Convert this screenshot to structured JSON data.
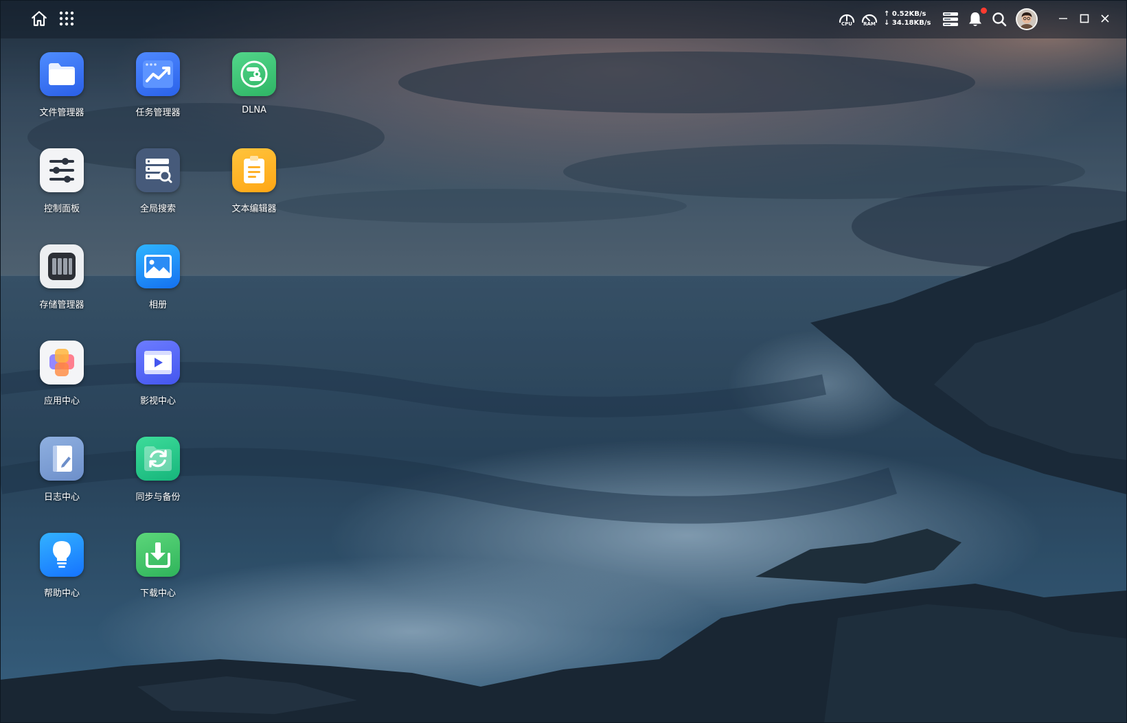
{
  "colors": {
    "topbar": "#141e2a",
    "notification_dot": "#ff3b30",
    "label_text": "#ffffff"
  },
  "topbar": {
    "home_icon": "home-icon",
    "apps_icon": "grid-icon",
    "cpu_label": "CPU",
    "ram_label": "RAM",
    "upload_speed": "↑ 0.52KB/s",
    "download_speed": "↓ 34.18KB/s",
    "storage_icon": "storage-icon",
    "bell_icon": "bell-icon",
    "search_icon": "search-icon",
    "avatar_icon": "avatar",
    "minimize_icon": "minimize-icon",
    "maximize_icon": "maximize-icon",
    "close_icon": "close-icon"
  },
  "desktop": {
    "icons": [
      {
        "label": "文件管理器",
        "icon": "folder-icon"
      },
      {
        "label": "任务管理器",
        "icon": "task-manager-icon"
      },
      {
        "label": "DLNA",
        "icon": "dlna-icon"
      },
      {
        "label": "控制面板",
        "icon": "control-panel-icon"
      },
      {
        "label": "全局搜索",
        "icon": "global-search-icon"
      },
      {
        "label": "文本编辑器",
        "icon": "text-editor-icon"
      },
      {
        "label": "存储管理器",
        "icon": "storage-manager-icon"
      },
      {
        "label": "相册",
        "icon": "photo-album-icon"
      },
      {
        "label": "应用中心",
        "icon": "app-center-icon"
      },
      {
        "label": "影视中心",
        "icon": "video-center-icon"
      },
      {
        "label": "日志中心",
        "icon": "log-center-icon"
      },
      {
        "label": "同步与备份",
        "icon": "sync-backup-icon"
      },
      {
        "label": "帮助中心",
        "icon": "help-center-icon"
      },
      {
        "label": "下载中心",
        "icon": "download-center-icon"
      }
    ]
  }
}
